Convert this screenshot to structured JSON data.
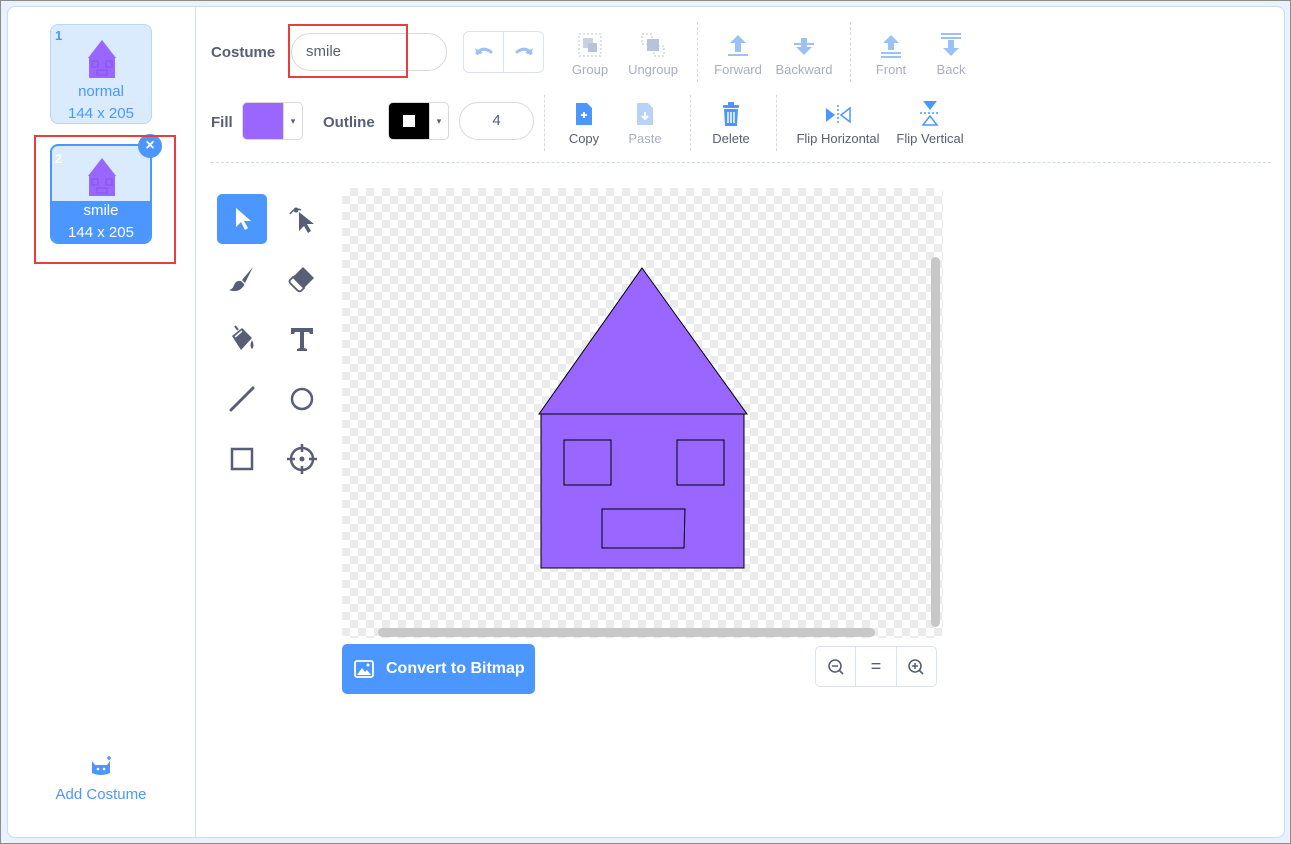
{
  "costumes": [
    {
      "number": "1",
      "name": "normal",
      "size": "144 x 205"
    },
    {
      "number": "2",
      "name": "smile",
      "size": "144 x 205"
    }
  ],
  "add_costume_label": "Add Costume",
  "toolbar": {
    "costume_label": "Costume",
    "costume_name": "smile",
    "group": "Group",
    "ungroup": "Ungroup",
    "forward": "Forward",
    "backward": "Backward",
    "front": "Front",
    "back": "Back",
    "fill_label": "Fill",
    "outline_label": "Outline",
    "outline_width": "4",
    "copy": "Copy",
    "paste": "Paste",
    "delete": "Delete",
    "flip_horizontal": "Flip Horizontal",
    "flip_vertical": "Flip Vertical"
  },
  "colors": {
    "fill": "#9966ff",
    "outline": "#000000",
    "accent": "#4c97ff",
    "highlight": "#e5403f"
  },
  "tools": [
    "select",
    "reshape",
    "brush",
    "eraser",
    "fill",
    "text",
    "line",
    "circle",
    "rectangle",
    "center"
  ],
  "convert_label": "Convert to Bitmap",
  "zoom": {
    "out": "zoom-out-icon",
    "reset": "=",
    "in": "zoom-in-icon"
  }
}
